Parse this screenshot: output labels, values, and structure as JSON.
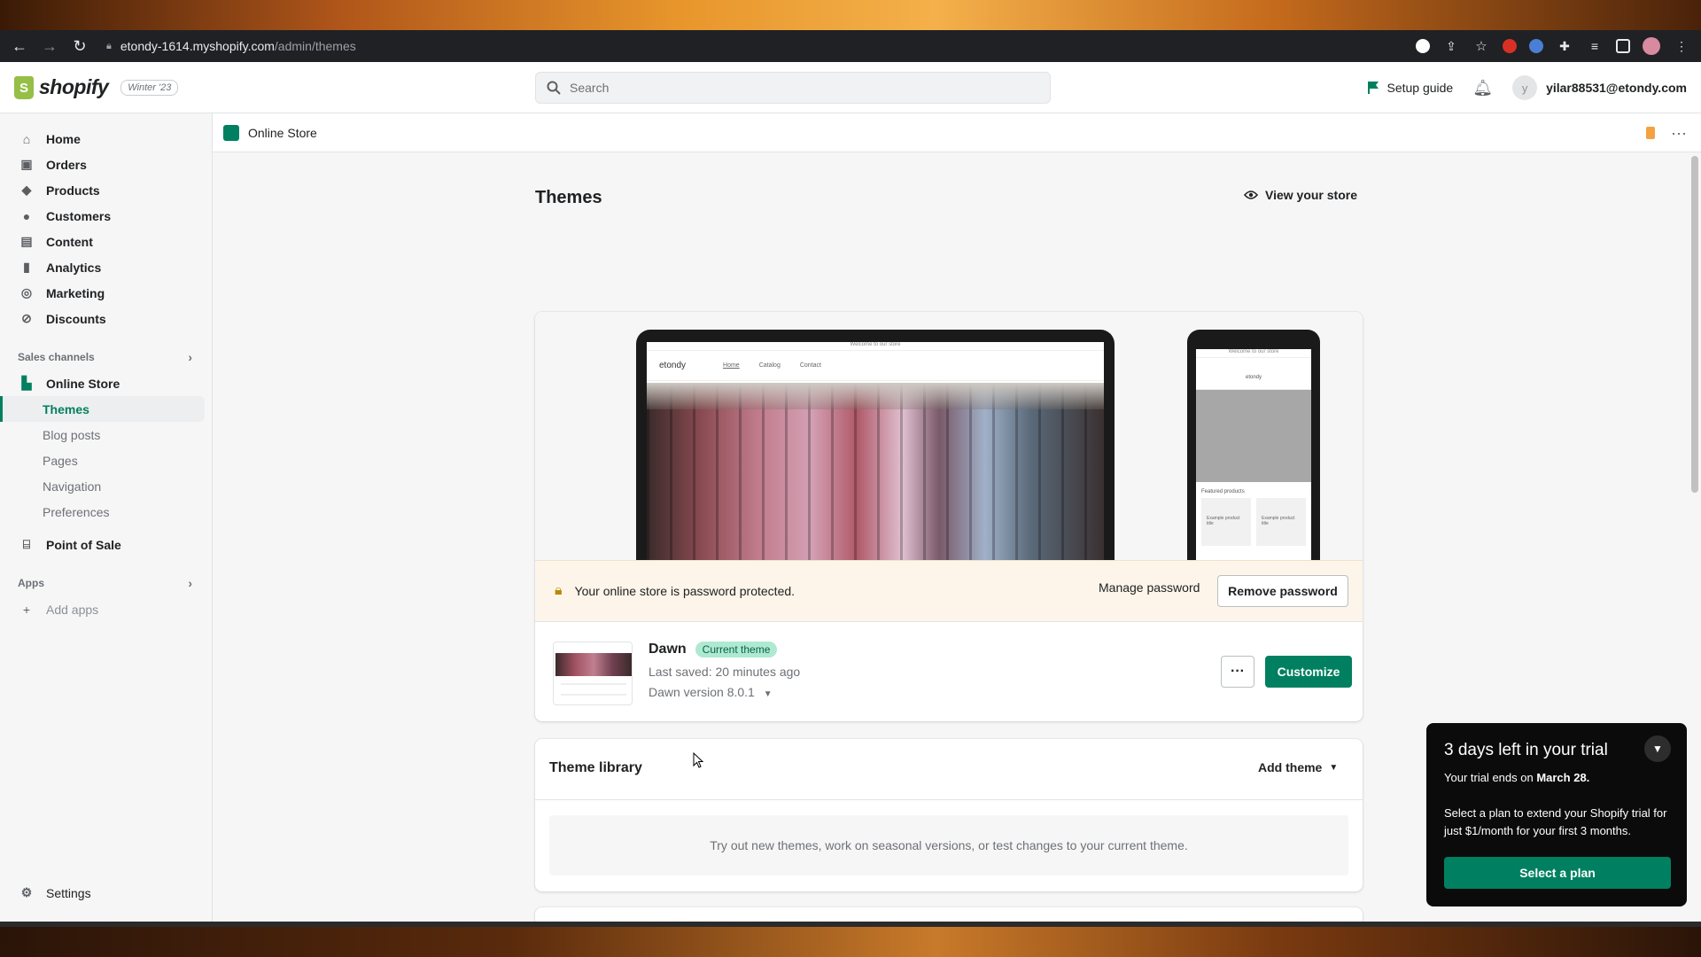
{
  "browser": {
    "url_host": "etondy-1614.myshopify.com",
    "url_path": "/admin/themes"
  },
  "topbar": {
    "logo_text": "shopify",
    "edition_badge": "Winter '23",
    "search_placeholder": "Search",
    "setup_guide": "Setup guide",
    "avatar_initial": "y",
    "user_email": "yilar88531@etondy.com"
  },
  "sidebar": {
    "items": [
      {
        "label": "Home",
        "icon": "home-icon"
      },
      {
        "label": "Orders",
        "icon": "orders-icon"
      },
      {
        "label": "Products",
        "icon": "tag-icon"
      },
      {
        "label": "Customers",
        "icon": "person-icon"
      },
      {
        "label": "Content",
        "icon": "content-icon"
      },
      {
        "label": "Analytics",
        "icon": "bar-chart-icon"
      },
      {
        "label": "Marketing",
        "icon": "target-icon"
      },
      {
        "label": "Discounts",
        "icon": "discount-icon"
      }
    ],
    "sales_channels_label": "Sales channels",
    "online_store": "Online Store",
    "online_store_sub": [
      "Themes",
      "Blog posts",
      "Pages",
      "Navigation",
      "Preferences"
    ],
    "point_of_sale": "Point of Sale",
    "apps_label": "Apps",
    "add_apps": "Add apps",
    "settings": "Settings"
  },
  "crumbbar": {
    "title": "Online Store"
  },
  "main": {
    "page_title": "Themes",
    "view_store": "View your store",
    "preview": {
      "announcement": "Welcome to our store",
      "brand": "etondy",
      "nav": [
        "Home",
        "Catalog",
        "Contact"
      ],
      "mobile_featured": "Featured products",
      "mobile_product": "Example product title"
    },
    "password_banner": {
      "message": "Your online store is password protected.",
      "manage": "Manage password",
      "remove": "Remove password"
    },
    "current_theme": {
      "name": "Dawn",
      "badge": "Current theme",
      "last_saved": "Last saved: 20 minutes ago",
      "version": "Dawn version 8.0.1",
      "more": "···",
      "customize": "Customize"
    },
    "library": {
      "title": "Theme library",
      "add_theme": "Add theme",
      "empty_text": "Try out new themes, work on seasonal versions, or test changes to your current theme."
    }
  },
  "trial": {
    "title": "3 days left in your trial",
    "ends_prefix": "Your trial ends on ",
    "ends_date": "March 28.",
    "body": "Select a plan to extend your Shopify trial for just $1/month for your first 3 months.",
    "cta": "Select a plan"
  },
  "colors": {
    "accent": "#008060",
    "badge_bg": "#aee9d1",
    "banner_bg": "#fdf5ea"
  }
}
